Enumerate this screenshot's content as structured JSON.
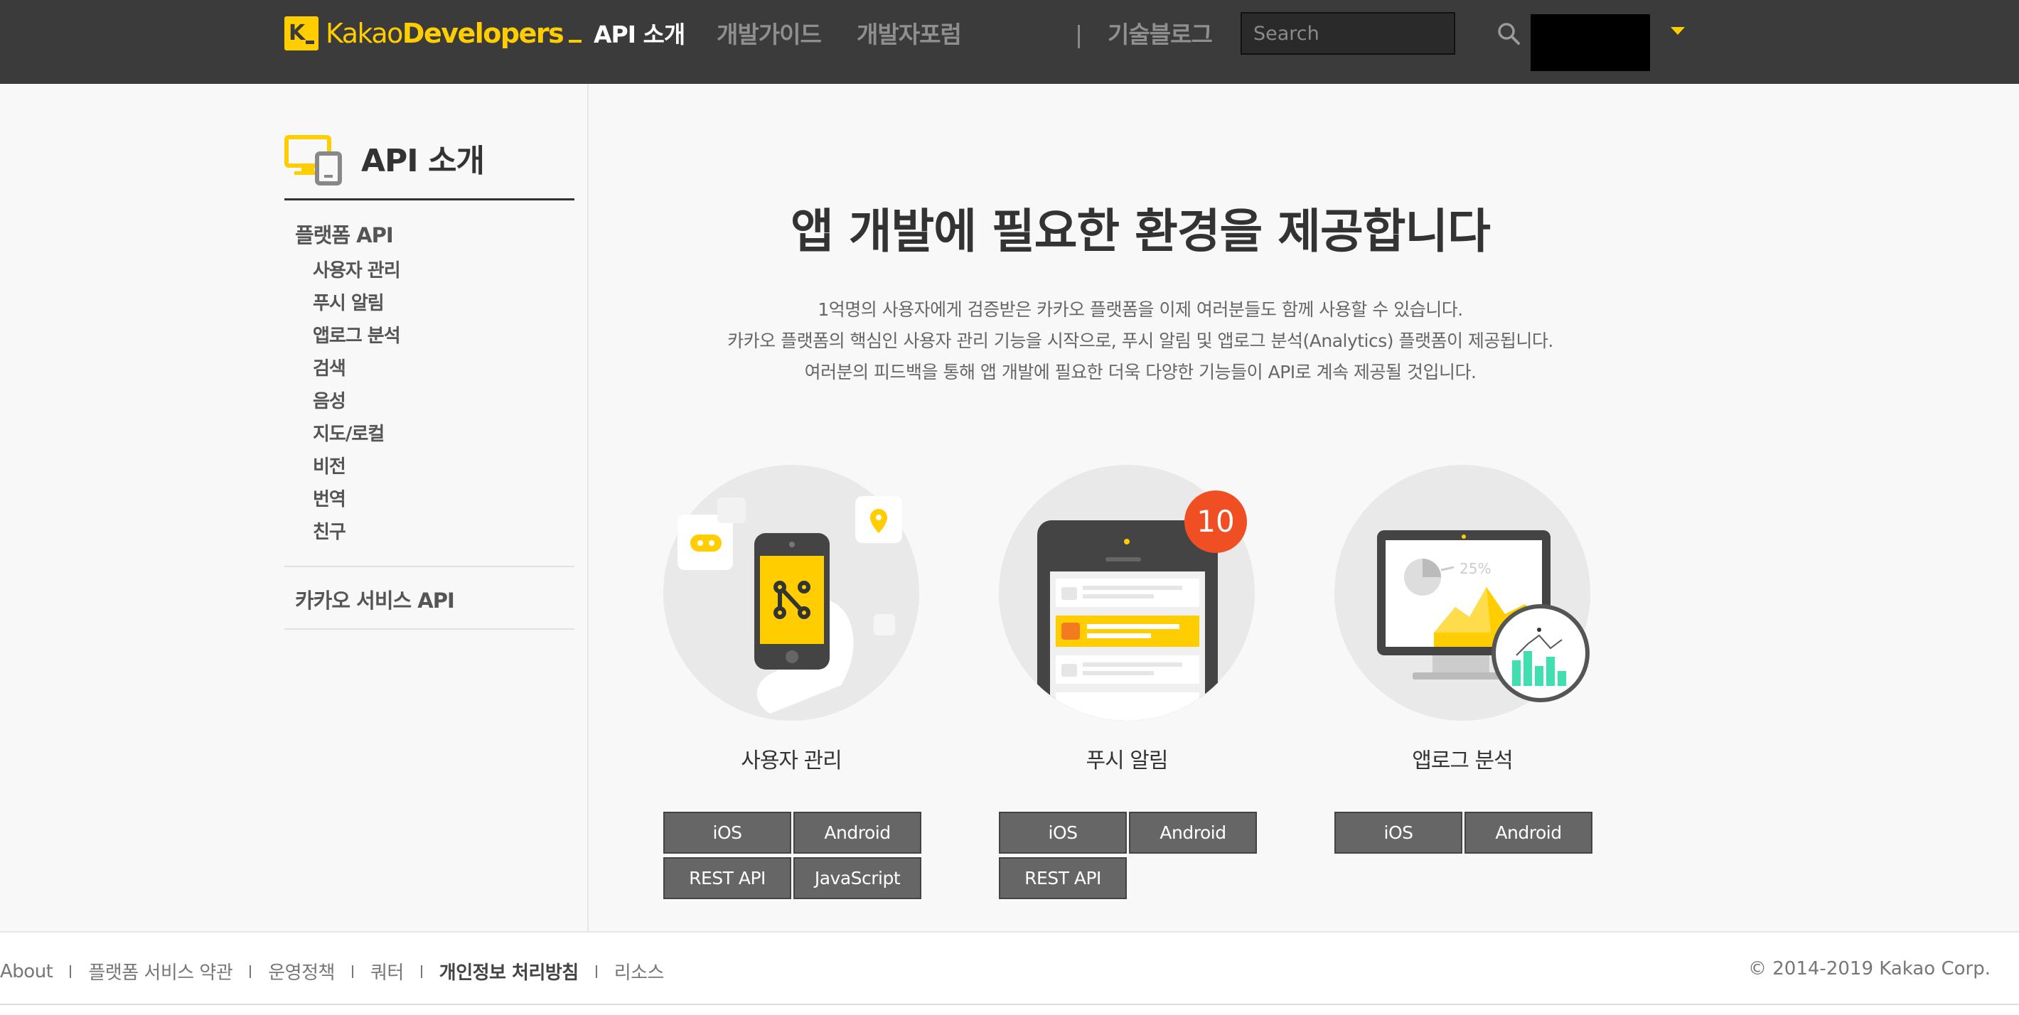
{
  "header": {
    "logo_kakao": "Kakao",
    "logo_developers": "Developers",
    "nav": {
      "api": "API 소개",
      "guide": "개발가이드",
      "forum": "개발자포럼",
      "separator": "|",
      "blog": "기술블로그"
    },
    "search": {
      "placeholder": "Search",
      "value": ""
    }
  },
  "sidebar": {
    "title": "API 소개",
    "group_platform": "플랫폼 API",
    "items": [
      {
        "label": "사용자 관리"
      },
      {
        "label": "푸시 알림"
      },
      {
        "label": "앱로그 분석"
      },
      {
        "label": "검색"
      },
      {
        "label": "음성"
      },
      {
        "label": "지도/로컬"
      },
      {
        "label": "비전"
      },
      {
        "label": "번역"
      },
      {
        "label": "친구"
      }
    ],
    "group_kakao": "카카오 서비스 API"
  },
  "main": {
    "title": "앱 개발에 필요한 환경을 제공합니다",
    "desc": [
      "1억명의 사용자에게 검증받은 카카오 플랫폼을 이제 여러분들도 함께 사용할 수 있습니다.",
      "카카오 플랫폼의 핵심인 사용자 관리 기능을 시작으로, 푸시 알림 및 앱로그 분석(Analytics) 플랫폼이 제공됩니다.",
      "여러분의 피드백을 통해 앱 개발에 필요한 더욱 다양한 기능들이 API로 계속 제공될 것입니다."
    ],
    "features": [
      {
        "label": "사용자 관리",
        "buttons": [
          "iOS",
          "Android",
          "REST API",
          "JavaScript"
        ]
      },
      {
        "label": "푸시 알림",
        "badge": "10",
        "buttons": [
          "iOS",
          "Android",
          "REST API"
        ]
      },
      {
        "label": "앱로그 분석",
        "chart_text": "25%",
        "buttons": [
          "iOS",
          "Android"
        ]
      }
    ]
  },
  "footer": {
    "links": [
      "About",
      "플랫폼 서비스 약관",
      "운영정책",
      "쿼터",
      "개인정보 처리방침",
      "리소스"
    ],
    "copyright": "© 2014-2019 Kakao Corp."
  },
  "colors": {
    "header_bg": "#3b3b3b",
    "accent_yellow": "#ffcd00",
    "button_bg": "#666666",
    "badge_red": "#f04e23"
  }
}
